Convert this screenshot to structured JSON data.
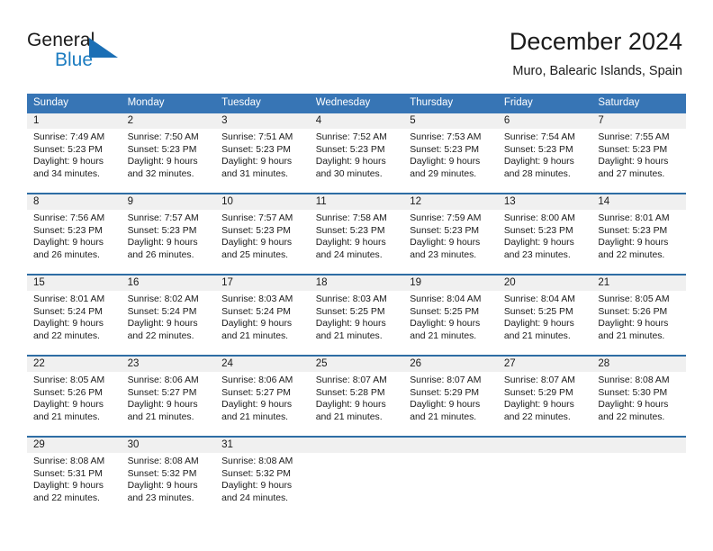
{
  "brand": {
    "name_top": "General",
    "name_bottom": "Blue",
    "flag_icon": "triangle-flag-icon",
    "top_color": "#1a1a1a",
    "bottom_color": "#1c7cc0",
    "flag_color": "#1b6fb5"
  },
  "header": {
    "title": "December 2024",
    "subtitle": "Muro, Balearic Islands, Spain"
  },
  "theme": {
    "header_bg": "#3775b5",
    "header_text": "#ffffff",
    "row_divider": "#2e6da4",
    "daynum_band_bg": "#f0f0f0",
    "text": "#1a1a1a",
    "page_bg": "#ffffff"
  },
  "weekdays": [
    "Sunday",
    "Monday",
    "Tuesday",
    "Wednesday",
    "Thursday",
    "Friday",
    "Saturday"
  ],
  "weeks": [
    [
      {
        "day": "1",
        "lines": [
          "Sunrise: 7:49 AM",
          "Sunset: 5:23 PM",
          "Daylight: 9 hours",
          "and 34 minutes."
        ]
      },
      {
        "day": "2",
        "lines": [
          "Sunrise: 7:50 AM",
          "Sunset: 5:23 PM",
          "Daylight: 9 hours",
          "and 32 minutes."
        ]
      },
      {
        "day": "3",
        "lines": [
          "Sunrise: 7:51 AM",
          "Sunset: 5:23 PM",
          "Daylight: 9 hours",
          "and 31 minutes."
        ]
      },
      {
        "day": "4",
        "lines": [
          "Sunrise: 7:52 AM",
          "Sunset: 5:23 PM",
          "Daylight: 9 hours",
          "and 30 minutes."
        ]
      },
      {
        "day": "5",
        "lines": [
          "Sunrise: 7:53 AM",
          "Sunset: 5:23 PM",
          "Daylight: 9 hours",
          "and 29 minutes."
        ]
      },
      {
        "day": "6",
        "lines": [
          "Sunrise: 7:54 AM",
          "Sunset: 5:23 PM",
          "Daylight: 9 hours",
          "and 28 minutes."
        ]
      },
      {
        "day": "7",
        "lines": [
          "Sunrise: 7:55 AM",
          "Sunset: 5:23 PM",
          "Daylight: 9 hours",
          "and 27 minutes."
        ]
      }
    ],
    [
      {
        "day": "8",
        "lines": [
          "Sunrise: 7:56 AM",
          "Sunset: 5:23 PM",
          "Daylight: 9 hours",
          "and 26 minutes."
        ]
      },
      {
        "day": "9",
        "lines": [
          "Sunrise: 7:57 AM",
          "Sunset: 5:23 PM",
          "Daylight: 9 hours",
          "and 26 minutes."
        ]
      },
      {
        "day": "10",
        "lines": [
          "Sunrise: 7:57 AM",
          "Sunset: 5:23 PM",
          "Daylight: 9 hours",
          "and 25 minutes."
        ]
      },
      {
        "day": "11",
        "lines": [
          "Sunrise: 7:58 AM",
          "Sunset: 5:23 PM",
          "Daylight: 9 hours",
          "and 24 minutes."
        ]
      },
      {
        "day": "12",
        "lines": [
          "Sunrise: 7:59 AM",
          "Sunset: 5:23 PM",
          "Daylight: 9 hours",
          "and 23 minutes."
        ]
      },
      {
        "day": "13",
        "lines": [
          "Sunrise: 8:00 AM",
          "Sunset: 5:23 PM",
          "Daylight: 9 hours",
          "and 23 minutes."
        ]
      },
      {
        "day": "14",
        "lines": [
          "Sunrise: 8:01 AM",
          "Sunset: 5:23 PM",
          "Daylight: 9 hours",
          "and 22 minutes."
        ]
      }
    ],
    [
      {
        "day": "15",
        "lines": [
          "Sunrise: 8:01 AM",
          "Sunset: 5:24 PM",
          "Daylight: 9 hours",
          "and 22 minutes."
        ]
      },
      {
        "day": "16",
        "lines": [
          "Sunrise: 8:02 AM",
          "Sunset: 5:24 PM",
          "Daylight: 9 hours",
          "and 22 minutes."
        ]
      },
      {
        "day": "17",
        "lines": [
          "Sunrise: 8:03 AM",
          "Sunset: 5:24 PM",
          "Daylight: 9 hours",
          "and 21 minutes."
        ]
      },
      {
        "day": "18",
        "lines": [
          "Sunrise: 8:03 AM",
          "Sunset: 5:25 PM",
          "Daylight: 9 hours",
          "and 21 minutes."
        ]
      },
      {
        "day": "19",
        "lines": [
          "Sunrise: 8:04 AM",
          "Sunset: 5:25 PM",
          "Daylight: 9 hours",
          "and 21 minutes."
        ]
      },
      {
        "day": "20",
        "lines": [
          "Sunrise: 8:04 AM",
          "Sunset: 5:25 PM",
          "Daylight: 9 hours",
          "and 21 minutes."
        ]
      },
      {
        "day": "21",
        "lines": [
          "Sunrise: 8:05 AM",
          "Sunset: 5:26 PM",
          "Daylight: 9 hours",
          "and 21 minutes."
        ]
      }
    ],
    [
      {
        "day": "22",
        "lines": [
          "Sunrise: 8:05 AM",
          "Sunset: 5:26 PM",
          "Daylight: 9 hours",
          "and 21 minutes."
        ]
      },
      {
        "day": "23",
        "lines": [
          "Sunrise: 8:06 AM",
          "Sunset: 5:27 PM",
          "Daylight: 9 hours",
          "and 21 minutes."
        ]
      },
      {
        "day": "24",
        "lines": [
          "Sunrise: 8:06 AM",
          "Sunset: 5:27 PM",
          "Daylight: 9 hours",
          "and 21 minutes."
        ]
      },
      {
        "day": "25",
        "lines": [
          "Sunrise: 8:07 AM",
          "Sunset: 5:28 PM",
          "Daylight: 9 hours",
          "and 21 minutes."
        ]
      },
      {
        "day": "26",
        "lines": [
          "Sunrise: 8:07 AM",
          "Sunset: 5:29 PM",
          "Daylight: 9 hours",
          "and 21 minutes."
        ]
      },
      {
        "day": "27",
        "lines": [
          "Sunrise: 8:07 AM",
          "Sunset: 5:29 PM",
          "Daylight: 9 hours",
          "and 22 minutes."
        ]
      },
      {
        "day": "28",
        "lines": [
          "Sunrise: 8:08 AM",
          "Sunset: 5:30 PM",
          "Daylight: 9 hours",
          "and 22 minutes."
        ]
      }
    ],
    [
      {
        "day": "29",
        "lines": [
          "Sunrise: 8:08 AM",
          "Sunset: 5:31 PM",
          "Daylight: 9 hours",
          "and 22 minutes."
        ]
      },
      {
        "day": "30",
        "lines": [
          "Sunrise: 8:08 AM",
          "Sunset: 5:32 PM",
          "Daylight: 9 hours",
          "and 23 minutes."
        ]
      },
      {
        "day": "31",
        "lines": [
          "Sunrise: 8:08 AM",
          "Sunset: 5:32 PM",
          "Daylight: 9 hours",
          "and 24 minutes."
        ]
      },
      {
        "day": "",
        "lines": []
      },
      {
        "day": "",
        "lines": []
      },
      {
        "day": "",
        "lines": []
      },
      {
        "day": "",
        "lines": []
      }
    ]
  ]
}
